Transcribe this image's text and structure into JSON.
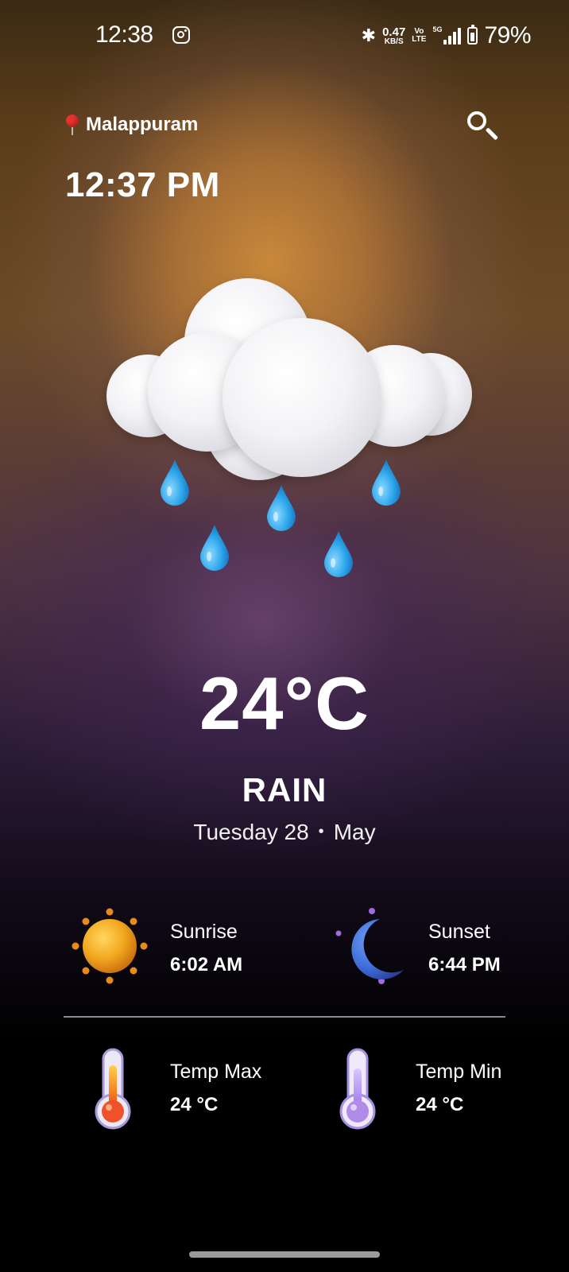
{
  "status_bar": {
    "time": "12:38",
    "net_speed_value": "0.47",
    "net_speed_unit": "KB/S",
    "volte_top": "Vo",
    "volte_bottom": "LTE",
    "network": "5G",
    "battery": "79%"
  },
  "header": {
    "location": "Malappuram",
    "current_time": "12:37 PM"
  },
  "weather": {
    "temperature": "24°C",
    "condition": "RAIN",
    "date_day": "Tuesday 28",
    "date_separator": "•",
    "date_month": "May"
  },
  "details": {
    "sunrise_label": "Sunrise",
    "sunrise_value": "6:02 AM",
    "sunset_label": "Sunset",
    "sunset_value": "6:44 PM",
    "temp_max_label": "Temp Max",
    "temp_max_value": "24 °C",
    "temp_min_label": "Temp Min",
    "temp_min_value": "24 °C"
  },
  "icons": {
    "location": "map-pin-icon",
    "search": "search-icon",
    "weather": "rain-cloud-icon",
    "sunrise": "sun-icon",
    "sunset": "moon-icon",
    "temp_max": "thermometer-hot-icon",
    "temp_min": "thermometer-cold-icon"
  },
  "colors": {
    "pin": "#e8322f",
    "raindrop": "#2fa8ec",
    "sun": "#f0a020",
    "moon": "#3f6ed8",
    "thermo_hot": "#f05020",
    "thermo_cold": "#b08be8"
  }
}
